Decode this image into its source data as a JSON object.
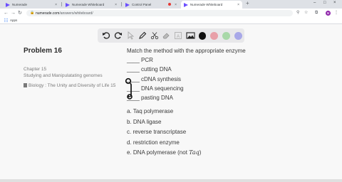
{
  "browser": {
    "tabs": [
      {
        "label": "Numerade",
        "active": false
      },
      {
        "label": "Numerade Whiteboard",
        "active": false
      },
      {
        "label": "Control Panel",
        "active": false
      },
      {
        "label": "Numerade Whiteboard",
        "active": true
      }
    ],
    "url_domain": "numerade.com",
    "url_path": "/answers/whiteboard/",
    "bookmarks": [
      "Apps"
    ],
    "avatar_letter": "M"
  },
  "whiteboard_toolbar": {
    "tools": [
      "undo-icon",
      "redo-icon",
      "pointer-icon",
      "pen-icon",
      "scissors-icon",
      "eraser-icon",
      "text-icon",
      "image-icon"
    ],
    "colors": [
      "#111111",
      "#e8a0a8",
      "#a8d8a8",
      "#a8a8e8"
    ]
  },
  "problem": {
    "title": "Problem 16",
    "chapter": "Chapter 15",
    "chapter_title": "Studying and Manipulatating genomes",
    "book": "Biology : The Unity and Diversity of Life 15"
  },
  "question": {
    "prompt": "Match the method with the appropriate enzyme",
    "blanks": [
      "____ PCR",
      "____ cutting DNA",
      "____ cDNA synthesis",
      "____ DNA sequencing",
      "____ pasting DNA"
    ],
    "options": [
      "a. Taq polymerase",
      "b. DNA ligase",
      "c. reverse transcriptase",
      "d. restriction enzyme",
      "e. DNA polymerase (not "
    ],
    "option_e_italic": "Taq",
    "option_e_tail": ")"
  }
}
